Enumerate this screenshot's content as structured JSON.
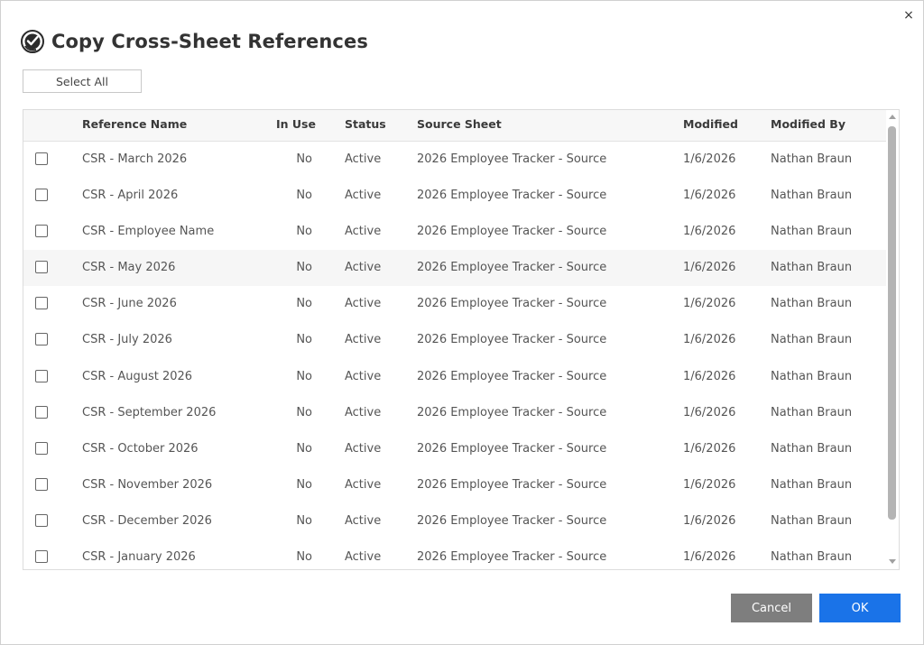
{
  "dialog": {
    "title": "Copy Cross-Sheet References",
    "close_symbol": "×",
    "select_all_label": "Select All",
    "cancel_label": "Cancel",
    "ok_label": "OK",
    "title_icon": "smartsheet-logo-icon"
  },
  "table": {
    "columns": {
      "name": "Reference Name",
      "in_use": "In Use",
      "status": "Status",
      "source": "Source Sheet",
      "modified": "Modified",
      "modified_by": "Modified By"
    },
    "rows": [
      {
        "name": "CSR - March 2026",
        "in_use": "No",
        "status": "Active",
        "source": "2026 Employee Tracker - Source",
        "modified": "1/6/2026",
        "modified_by": "Nathan Braun"
      },
      {
        "name": "CSR - April 2026",
        "in_use": "No",
        "status": "Active",
        "source": "2026 Employee Tracker - Source",
        "modified": "1/6/2026",
        "modified_by": "Nathan Braun"
      },
      {
        "name": "CSR - Employee Name",
        "in_use": "No",
        "status": "Active",
        "source": "2026 Employee Tracker - Source",
        "modified": "1/6/2026",
        "modified_by": "Nathan Braun"
      },
      {
        "name": "CSR - May 2026",
        "in_use": "No",
        "status": "Active",
        "source": "2026 Employee Tracker - Source",
        "modified": "1/6/2026",
        "modified_by": "Nathan Braun"
      },
      {
        "name": "CSR - June 2026",
        "in_use": "No",
        "status": "Active",
        "source": "2026 Employee Tracker - Source",
        "modified": "1/6/2026",
        "modified_by": "Nathan Braun"
      },
      {
        "name": "CSR - July 2026",
        "in_use": "No",
        "status": "Active",
        "source": "2026 Employee Tracker - Source",
        "modified": "1/6/2026",
        "modified_by": "Nathan Braun"
      },
      {
        "name": "CSR - August 2026",
        "in_use": "No",
        "status": "Active",
        "source": "2026 Employee Tracker - Source",
        "modified": "1/6/2026",
        "modified_by": "Nathan Braun"
      },
      {
        "name": "CSR - September 2026",
        "in_use": "No",
        "status": "Active",
        "source": "2026 Employee Tracker - Source",
        "modified": "1/6/2026",
        "modified_by": "Nathan Braun"
      },
      {
        "name": "CSR - October 2026",
        "in_use": "No",
        "status": "Active",
        "source": "2026 Employee Tracker - Source",
        "modified": "1/6/2026",
        "modified_by": "Nathan Braun"
      },
      {
        "name": "CSR - November 2026",
        "in_use": "No",
        "status": "Active",
        "source": "2026 Employee Tracker - Source",
        "modified": "1/6/2026",
        "modified_by": "Nathan Braun"
      },
      {
        "name": "CSR - December 2026",
        "in_use": "No",
        "status": "Active",
        "source": "2026 Employee Tracker - Source",
        "modified": "1/6/2026",
        "modified_by": "Nathan Braun"
      },
      {
        "name": "CSR - January 2026",
        "in_use": "No",
        "status": "Active",
        "source": "2026 Employee Tracker - Source",
        "modified": "1/6/2026",
        "modified_by": "Nathan Braun"
      }
    ],
    "hovered_row_index": 3
  },
  "colors": {
    "ok_button": "#1a73e8",
    "cancel_button": "#7e7e7e",
    "title_text": "#333333"
  }
}
